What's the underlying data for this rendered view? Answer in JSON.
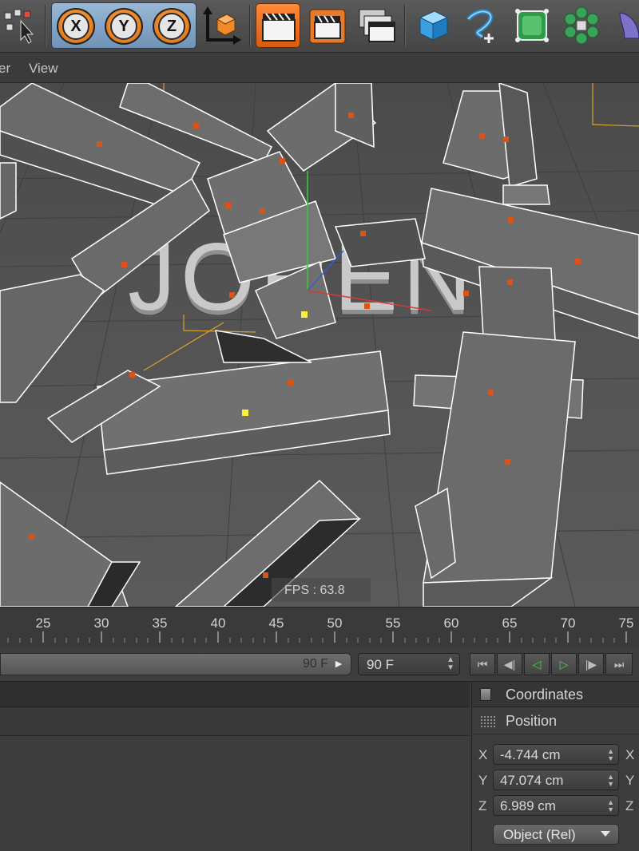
{
  "toolbar": {
    "axis_buttons": [
      {
        "label": "X",
        "icon": "axis-x-lock-icon"
      },
      {
        "label": "Y",
        "icon": "axis-y-lock-icon"
      },
      {
        "label": "Z",
        "icon": "axis-z-lock-icon"
      }
    ],
    "icons": [
      "live-selection-icon",
      "coordinate-system-icon",
      "render-view-icon",
      "render-to-picture-viewer-icon",
      "render-settings-icon",
      "cube-icon",
      "spline-pen-icon",
      "subdivision-surface-icon",
      "cloner-icon",
      "deformer-icon"
    ]
  },
  "menu": {
    "items": [
      "er",
      "View"
    ]
  },
  "viewport": {
    "fps_text": "FPS : 63.8",
    "scene_text": "JOREN"
  },
  "timeline": {
    "ticks": [
      "25",
      "30",
      "35",
      "40",
      "45",
      "50",
      "55",
      "60",
      "65",
      "70",
      "75"
    ]
  },
  "controls": {
    "range_value": "90 F",
    "frame_value": "90 F",
    "buttons": [
      "go-to-start-icon",
      "previous-key-icon",
      "play-backwards-icon",
      "play-forwards-icon",
      "next-key-icon",
      "go-to-end-icon"
    ]
  },
  "coordinates": {
    "title": "Coordinates",
    "section": "Position",
    "rows": [
      {
        "axis": "X",
        "value": "-4.744 cm",
        "axis2": "X"
      },
      {
        "axis": "Y",
        "value": "47.074 cm",
        "axis2": "Y"
      },
      {
        "axis": "Z",
        "value": "6.989 cm",
        "axis2": "Z"
      }
    ],
    "mode": "Object (Rel)"
  },
  "colors": {
    "accent_orange": "#f08a2a",
    "axis_blue": "#7e9fc2",
    "play_green": "#4ad24a",
    "selection_point": "#d9541a"
  }
}
